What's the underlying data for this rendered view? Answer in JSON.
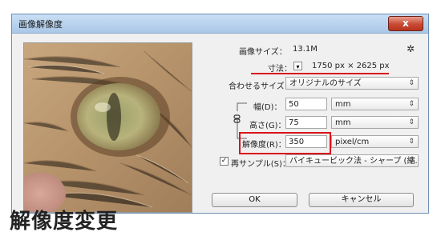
{
  "window": {
    "title": "画像解像度",
    "close_glyph": "x"
  },
  "image_size": {
    "label": "画像サイズ：",
    "value": "13.1M",
    "gear_glyph": "✲"
  },
  "dimensions": {
    "label": "寸法：",
    "dropdown_glyph": "▾",
    "value": "1750 px × 2625 px"
  },
  "fit": {
    "label": "合わせるサイズ：",
    "selected": "オリジナルのサイズ"
  },
  "width": {
    "label": "幅(D)：",
    "value": "50",
    "unit": "mm"
  },
  "height": {
    "label": "高さ(G)：",
    "value": "75",
    "unit": "mm"
  },
  "resolution": {
    "label": "解像度(R)：",
    "value": "350",
    "unit": "pixel/cm"
  },
  "resample": {
    "label": "再サンプル(S)：",
    "checked": true,
    "method": "バイキュービック法 - シャープ (縮..."
  },
  "buttons": {
    "ok": "OK",
    "cancel": "キャンセル"
  },
  "caption": "解像度変更",
  "colors": {
    "highlight": "#d9141d",
    "titlebar": "#b9d3ee"
  },
  "select_arrow": "⇕"
}
